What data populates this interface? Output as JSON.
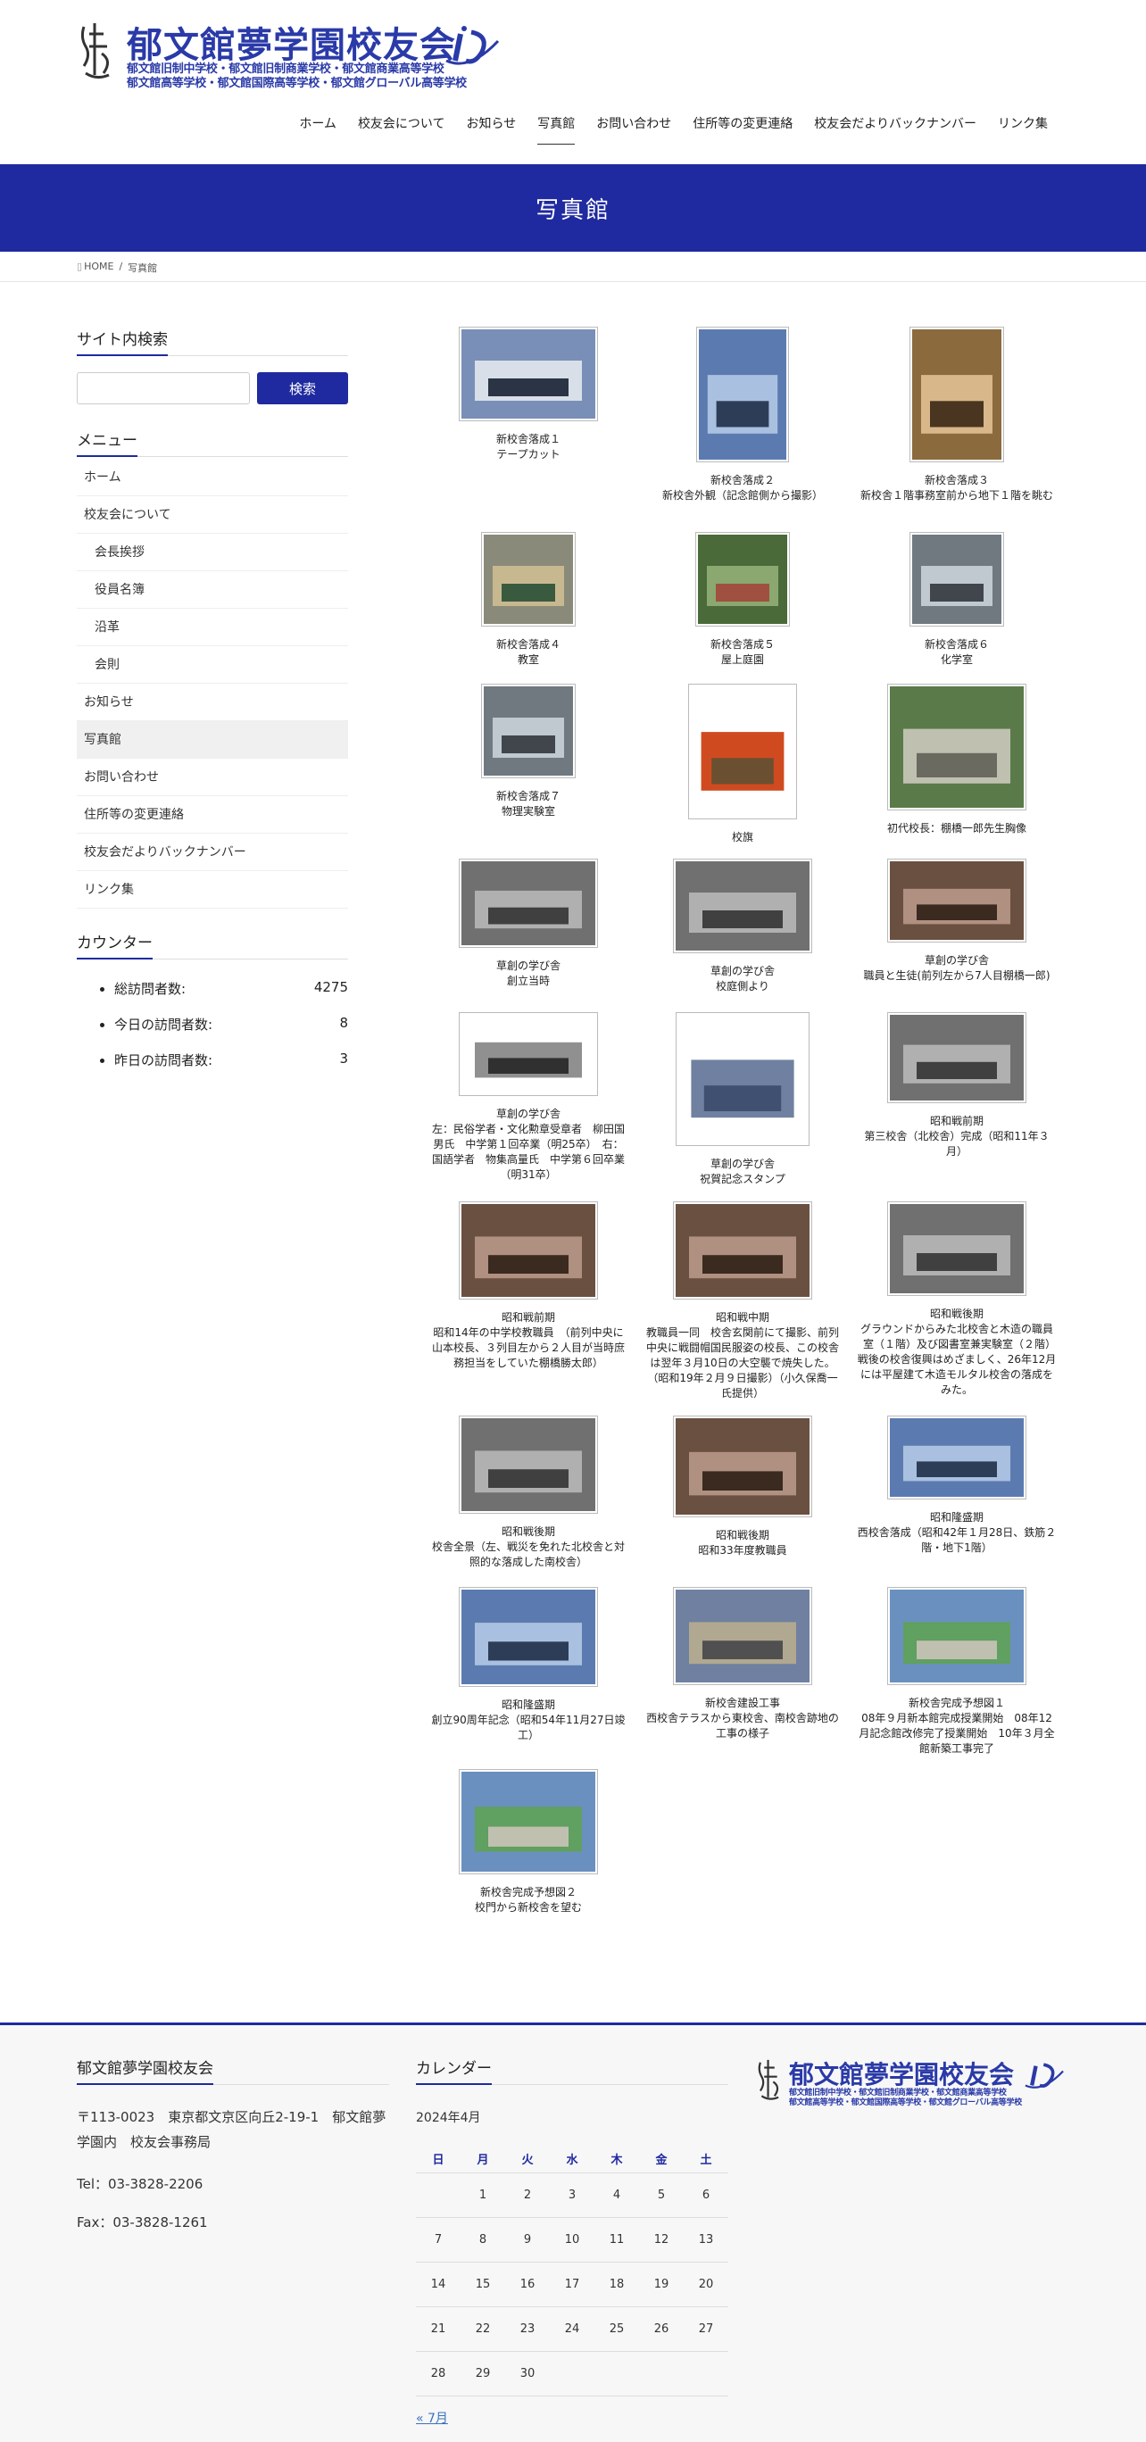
{
  "site": {
    "logo_title": "郁文館夢学園校友会",
    "logo_sub1": "郁文館旧制中学校・郁文館旧制商業学校・郁文館商業高等学校",
    "logo_sub2": "郁文館高等学校・郁文館国際高等学校・郁文館グローバル高等学校"
  },
  "nav": [
    {
      "label": "ホーム"
    },
    {
      "label": "校友会について"
    },
    {
      "label": "お知らせ"
    },
    {
      "label": "写真館"
    },
    {
      "label": "お問い合わせ"
    },
    {
      "label": "住所等の変更連絡"
    },
    {
      "label": "校友会だよりバックナンバー"
    },
    {
      "label": "リンク集"
    }
  ],
  "page_title": "写真館",
  "breadcrumb": {
    "home": "HOME",
    "sep": "/",
    "current": "写真館"
  },
  "sidebar": {
    "search_heading": "サイト内検索",
    "search_button": "検索",
    "menu_heading": "メニュー",
    "menu": [
      {
        "label": "ホーム",
        "sub": false
      },
      {
        "label": "校友会について",
        "sub": false
      },
      {
        "label": "会長挨拶",
        "sub": true
      },
      {
        "label": "役員名簿",
        "sub": true
      },
      {
        "label": "沿革",
        "sub": true
      },
      {
        "label": "会則",
        "sub": true
      },
      {
        "label": "お知らせ",
        "sub": false
      },
      {
        "label": "写真館",
        "sub": false,
        "active": true
      },
      {
        "label": "お問い合わせ",
        "sub": false
      },
      {
        "label": "住所等の変更連絡",
        "sub": false
      },
      {
        "label": "校友会だよりバックナンバー",
        "sub": false
      },
      {
        "label": "リンク集",
        "sub": false
      }
    ],
    "counter_heading": "カウンター",
    "counter": [
      {
        "label": "総訪問者数:",
        "value": "4275"
      },
      {
        "label": "今日の訪問者数:",
        "value": "8"
      },
      {
        "label": "昨日の訪問者数:",
        "value": "3"
      }
    ]
  },
  "gallery": [
    {
      "l1": "新校舎落成１",
      "l2": "テープカット",
      "icon": "ceremony-photo"
    },
    {
      "l1": "新校舎落成２",
      "l2": "新校舎外観（記念館側から撮影）",
      "icon": "building-photo"
    },
    {
      "l1": "新校舎落成３",
      "l2": "新校舎１階事務室前から地下１階を眺む",
      "icon": "atrium-photo"
    },
    {
      "l1": "新校舎落成４",
      "l2": "教室",
      "icon": "classroom-photo"
    },
    {
      "l1": "新校舎落成５",
      "l2": "屋上庭園",
      "icon": "garden-photo"
    },
    {
      "l1": "新校舎落成６",
      "l2": "化学室",
      "icon": "lab-photo"
    },
    {
      "l1": "新校舎落成７",
      "l2": "物理実験室",
      "icon": "lab-photo"
    },
    {
      "l1": "校旗",
      "l2": "",
      "icon": "flag-photo"
    },
    {
      "l1": "初代校長：棚橋一郎先生胸像",
      "l2": "",
      "icon": "bust-photo"
    },
    {
      "l1": "草創の学び舎",
      "l2": "創立当時",
      "icon": "old-building-photo"
    },
    {
      "l1": "草創の学び舎",
      "l2": "校庭側より",
      "icon": "old-building-photo"
    },
    {
      "l1": "草創の学び舎",
      "l2": "職員と生徒(前列左から7人目棚橋一郎)",
      "icon": "group-photo"
    },
    {
      "l1": "草創の学び舎",
      "l2": "左：民俗学者・文化勲章受章者　柳田国男氏　中学第１回卒業（明25卒）　右：国語学者　物集高量氏　中学第６回卒業（明31卒）",
      "icon": "portraits-photo"
    },
    {
      "l1": "草創の学び舎",
      "l2": "祝賀記念スタンプ",
      "icon": "stamp-photo"
    },
    {
      "l1": "昭和戦前期",
      "l2": "第三校舎（北校舎）完成（昭和11年３月）",
      "icon": "old-building-photo"
    },
    {
      "l1": "昭和戦前期",
      "l2": "昭和14年の中学校教職員　（前列中央に山本校長、３列目左から２人目が当時庶務担当をしていた棚橋勝太郎）",
      "icon": "group-photo"
    },
    {
      "l1": "昭和戦中期",
      "l2": "教職員一同　校舎玄関前にて撮影、前列中央に戦闘帽国民服姿の校長、この校舎は翌年３月10日の大空襲で焼失した。（昭和19年２月９日撮影）（小久保喬一氏提供）",
      "icon": "group-photo"
    },
    {
      "l1": "昭和戦後期",
      "l2": "グラウンドからみた北校舎と木造の職員室（１階）及び図書室兼実験室（２階）　戦後の校舎復興はめざましく、26年12月には平屋建て木造モルタル校舎の落成をみた。",
      "icon": "old-building-photo"
    },
    {
      "l1": "昭和戦後期",
      "l2": "校舎全景（左、戦災を免れた北校舎と対照的な落成した南校舎）",
      "icon": "old-building-photo"
    },
    {
      "l1": "昭和戦後期",
      "l2": "昭和33年度教職員",
      "icon": "group-photo"
    },
    {
      "l1": "昭和隆盛期",
      "l2": "西校舎落成（昭和42年１月28日、鉄筋２階・地下1階）",
      "icon": "building-photo"
    },
    {
      "l1": "昭和隆盛期",
      "l2": "創立90周年記念（昭和54年11月27日竣工）",
      "icon": "building-photo"
    },
    {
      "l1": "新校舎建設工事",
      "l2": "西校舎テラスから東校舎、南校舎跡地の工事の様子",
      "icon": "construction-photo"
    },
    {
      "l1": "新校舎完成予想図１",
      "l2": "08年９月新本館完成授業開始　08年12月記念館改修完了授業開始　10年３月全館新築工事完了",
      "icon": "rendering-photo"
    },
    {
      "l1": "新校舎完成予想図２",
      "l2": "校門から新校舎を望む",
      "icon": "rendering-photo"
    }
  ],
  "footer": {
    "org_heading": "郁文館夢学園校友会",
    "address": "〒113-0023　東京都文京区向丘2-19-1　郁文館夢学園内　校友会事務局",
    "tel": "Tel：03-3828-2206",
    "fax": "Fax：03-3828-1261",
    "cal_heading": "カレンダー",
    "cal_month": "2024年4月",
    "weekdays": [
      "日",
      "月",
      "火",
      "水",
      "木",
      "金",
      "土"
    ],
    "weeks": [
      [
        "",
        "1",
        "2",
        "3",
        "4",
        "5",
        "6"
      ],
      [
        "7",
        "8",
        "9",
        "10",
        "11",
        "12",
        "13"
      ],
      [
        "14",
        "15",
        "16",
        "17",
        "18",
        "19",
        "20"
      ],
      [
        "21",
        "22",
        "23",
        "24",
        "25",
        "26",
        "27"
      ],
      [
        "28",
        "29",
        "30",
        "",
        "",
        "",
        ""
      ]
    ],
    "cal_prev": "« 7月"
  },
  "colors": {
    "brand": "#1f2aa0",
    "link": "#3a70c0"
  }
}
